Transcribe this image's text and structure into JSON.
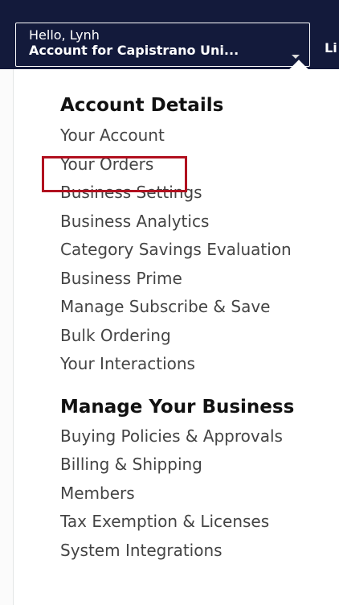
{
  "nav": {
    "greeting": "Hello, Lynh",
    "account_label": "Account for Capistrano Uni...",
    "next_nav_text": "Li"
  },
  "menu": {
    "sections": [
      {
        "title": "Account Details",
        "items": [
          "Your Account",
          "Your Orders",
          "Business Settings",
          "Business Analytics",
          "Category Savings Evaluation",
          "Business Prime",
          "Manage Subscribe & Save",
          "Bulk Ordering",
          "Your Interactions"
        ]
      },
      {
        "title": "Manage Your Business",
        "items": [
          "Buying Policies & Approvals",
          "Billing & Shipping",
          "Members",
          "Tax Exemption & Licenses",
          "System Integrations"
        ]
      }
    ]
  },
  "highlight": {
    "target_item": "Your Orders",
    "color": "#b1101f"
  },
  "colors": {
    "nav_background": "#131a3b",
    "menu_background": "#ffffff",
    "link_text": "#444444",
    "heading_text": "#111111"
  },
  "icons": {
    "account_dropdown": "caret-down-icon"
  }
}
